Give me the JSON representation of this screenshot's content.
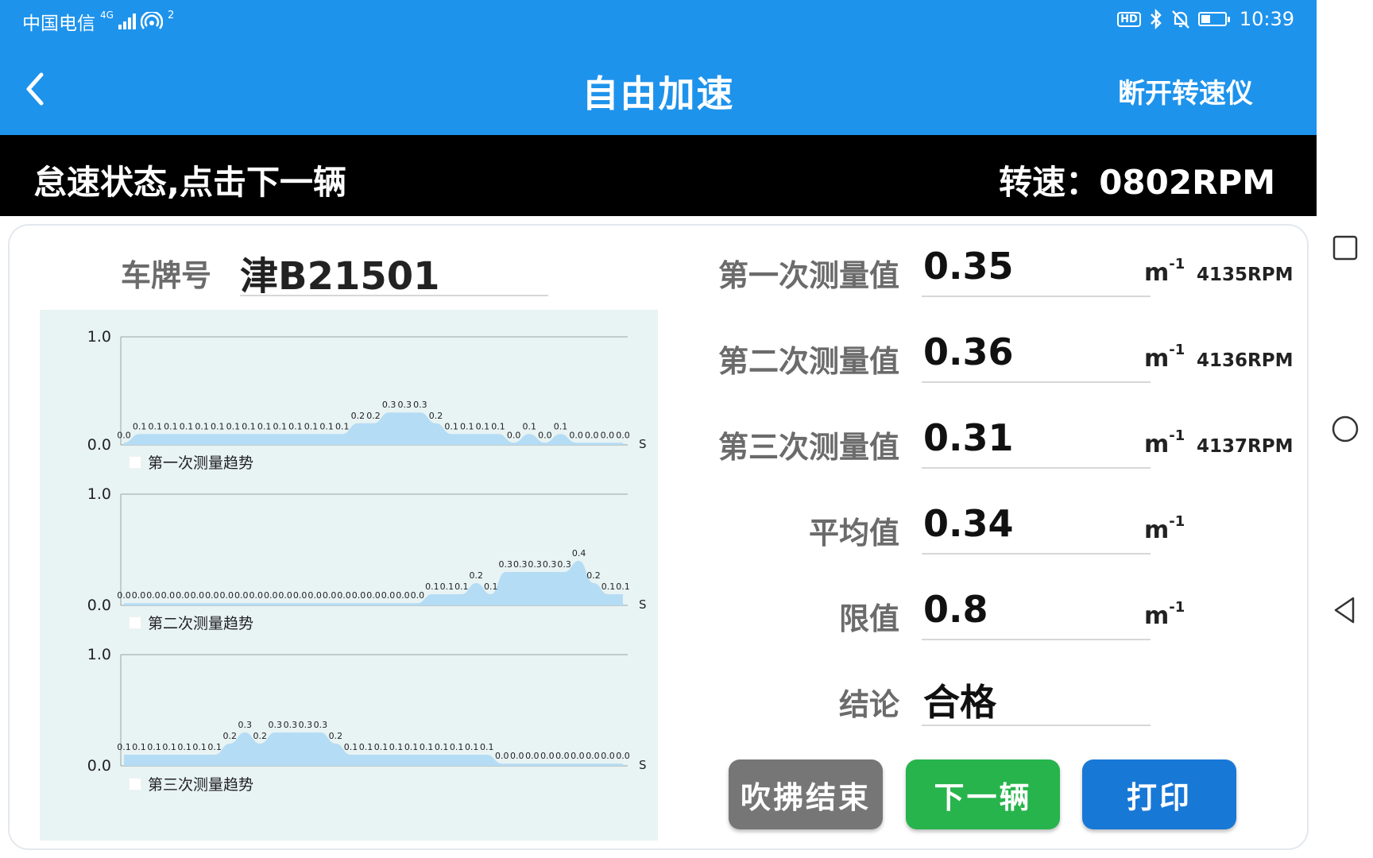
{
  "status_bar": {
    "carrier": "中国电信",
    "network_type": "4G",
    "hotspot_count": "2",
    "hd_badge": "HD",
    "time": "10:39",
    "battery_level": 0.35
  },
  "header": {
    "title": "自由加速",
    "disconnect_label": "断开转速仪"
  },
  "info_bar": {
    "status_message": "怠速状态,点击下一辆",
    "rpm_label": "转速：",
    "rpm_value": "0802RPM"
  },
  "plate": {
    "label": "车牌号",
    "value": "津B21501"
  },
  "measurements": [
    {
      "label": "第一次测量值",
      "value": "0.35",
      "unit": "m",
      "unit_exp": "-1",
      "rpm": "4135RPM"
    },
    {
      "label": "第二次测量值",
      "value": "0.36",
      "unit": "m",
      "unit_exp": "-1",
      "rpm": "4136RPM"
    },
    {
      "label": "第三次测量值",
      "value": "0.31",
      "unit": "m",
      "unit_exp": "-1",
      "rpm": "4137RPM"
    },
    {
      "label": "平均值",
      "value": "0.34",
      "unit": "m",
      "unit_exp": "-1",
      "rpm": ""
    },
    {
      "label": "限值",
      "value": "0.8",
      "unit": "m",
      "unit_exp": "-1",
      "rpm": ""
    },
    {
      "label": "结论",
      "value": "合格",
      "unit": "",
      "unit_exp": "",
      "rpm": ""
    }
  ],
  "buttons": {
    "end_label": "吹拂结束",
    "next_label": "下一辆",
    "print_label": "打印"
  },
  "colors": {
    "header_bg": "#1e93ec",
    "info_bg": "#000000",
    "chart_bg": "#e8f3f3",
    "area_fill": "#b5dcf5",
    "btn_end": "#767676",
    "btn_next": "#27b44c",
    "btn_print": "#1878d6"
  },
  "chart_data": [
    {
      "type": "area",
      "legend": "第一次测量趋势",
      "ylim": [
        0.0,
        1.0
      ],
      "y_ticks": [
        "0.0",
        "1.0"
      ],
      "x_unit": "S",
      "legend_position": "bottom-left",
      "values": [
        "0.0",
        "0.1",
        "0.1",
        "0.1",
        "0.1",
        "0.1",
        "0.1",
        "0.1",
        "0.1",
        "0.1",
        "0.1",
        "0.1",
        "0.1",
        "0.1",
        "0.1",
        "0.2",
        "0.2",
        "0.3",
        "0.3",
        "0.3",
        "0.2",
        "0.1",
        "0.1",
        "0.1",
        "0.1",
        "0.0",
        "0.1",
        "0.0",
        "0.1",
        "0.0",
        "0.0",
        "0.0",
        "0.0"
      ]
    },
    {
      "type": "area",
      "legend": "第二次测量趋势",
      "ylim": [
        0.0,
        1.0
      ],
      "y_ticks": [
        "0.0",
        "1.0"
      ],
      "x_unit": "S",
      "legend_position": "bottom-left",
      "values": [
        "0.0",
        "0.0",
        "0.0",
        "0.0",
        "0.0",
        "0.0",
        "0.0",
        "0.0",
        "0.0",
        "0.0",
        "0.0",
        "0.0",
        "0.0",
        "0.0",
        "0.0",
        "0.0",
        "0.0",
        "0.0",
        "0.0",
        "0.0",
        "0.0",
        "0.1",
        "0.1",
        "0.1",
        "0.2",
        "0.1",
        "0.3",
        "0.3",
        "0.3",
        "0.3",
        "0.3",
        "0.4",
        "0.2",
        "0.1",
        "0.1"
      ]
    },
    {
      "type": "area",
      "legend": "第三次测量趋势",
      "ylim": [
        0.0,
        1.0
      ],
      "y_ticks": [
        "0.0",
        "1.0"
      ],
      "x_unit": "S",
      "legend_position": "bottom-left",
      "values": [
        "0.1",
        "0.1",
        "0.1",
        "0.1",
        "0.1",
        "0.1",
        "0.1",
        "0.2",
        "0.3",
        "0.2",
        "0.3",
        "0.3",
        "0.3",
        "0.3",
        "0.2",
        "0.1",
        "0.1",
        "0.1",
        "0.1",
        "0.1",
        "0.1",
        "0.1",
        "0.1",
        "0.1",
        "0.1",
        "0.0",
        "0.0",
        "0.0",
        "0.0",
        "0.0",
        "0.0",
        "0.0",
        "0.0",
        "0.0"
      ]
    }
  ]
}
